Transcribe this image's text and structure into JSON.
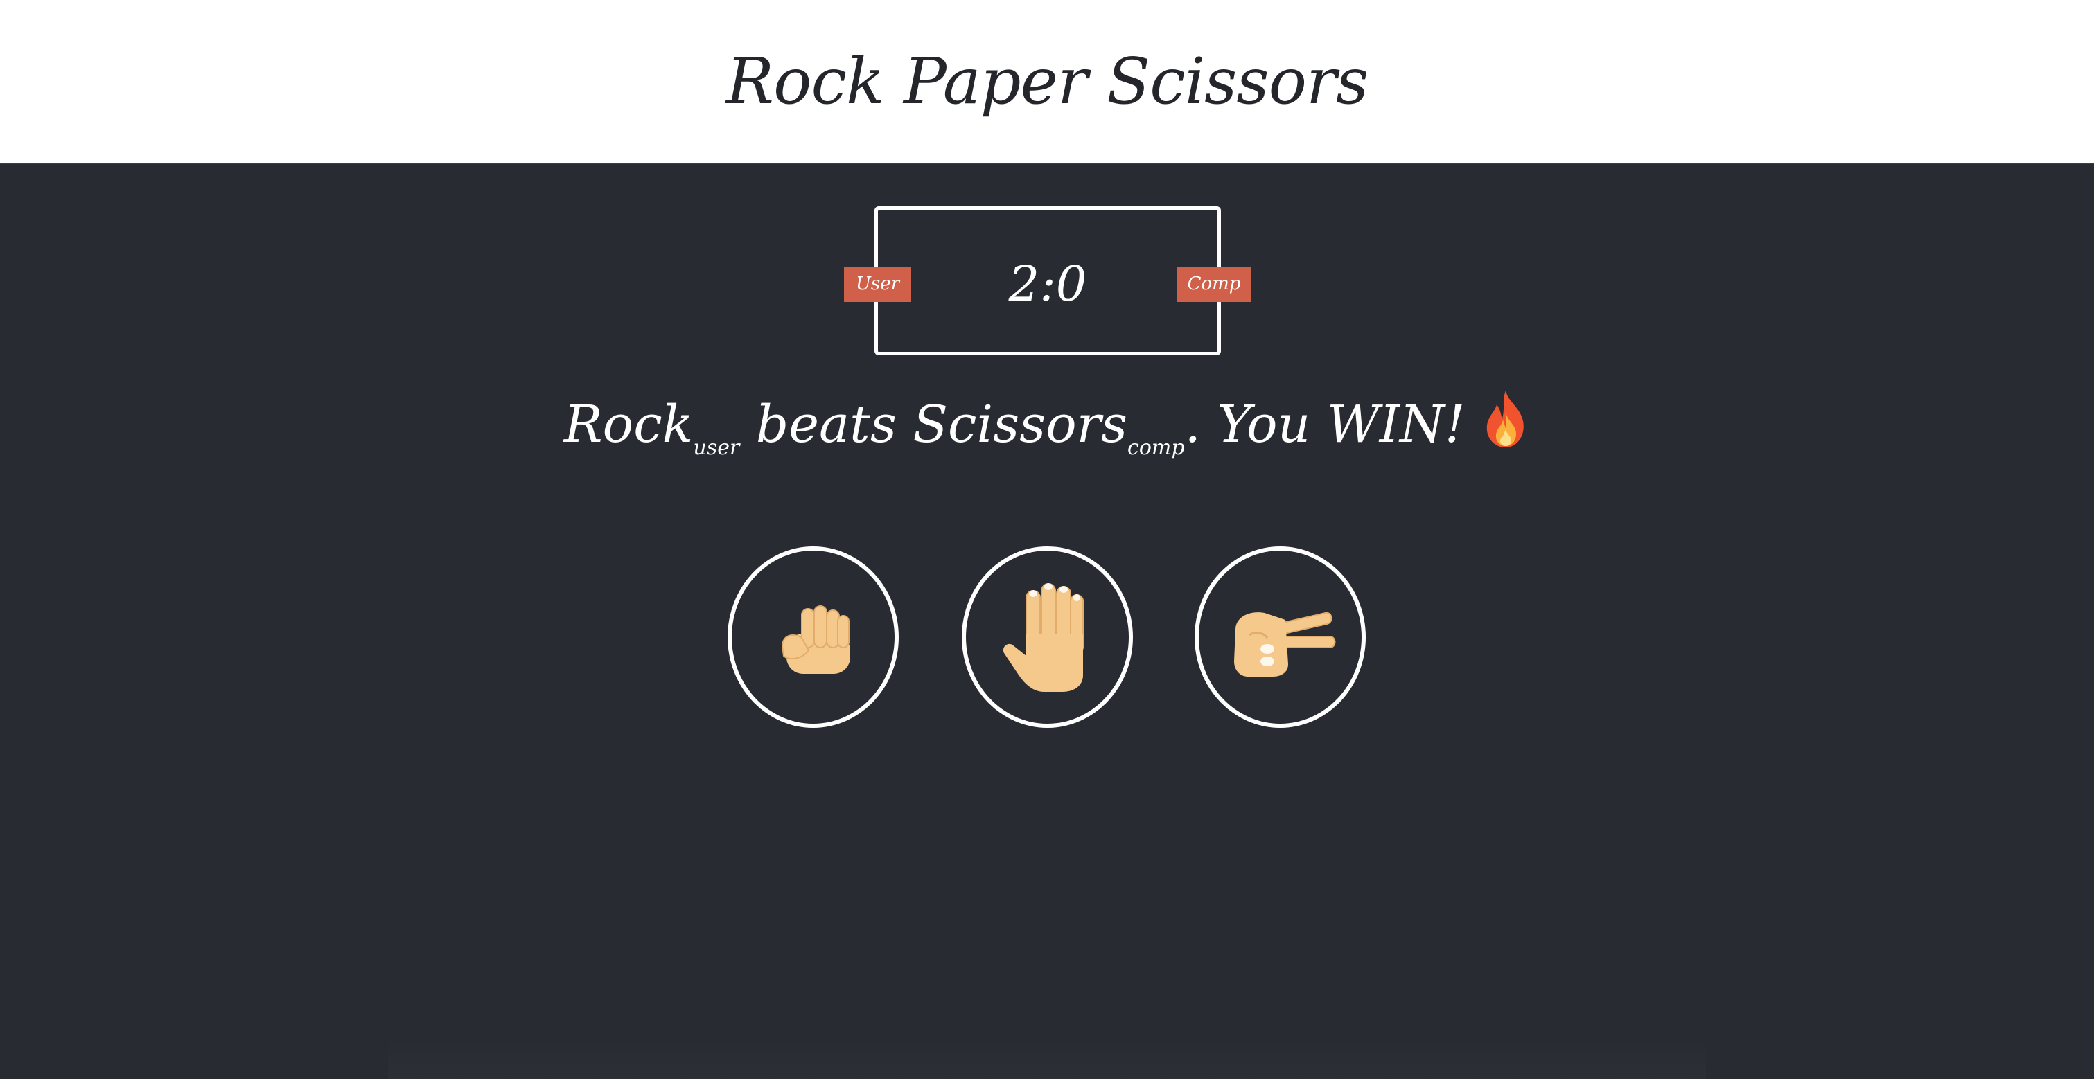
{
  "header": {
    "title": "Rock Paper Scissors"
  },
  "scoreboard": {
    "user_label": "User",
    "comp_label": "Comp",
    "score": "2:0"
  },
  "result": {
    "user_choice": "Rock",
    "user_tag": "user",
    "verb": "beats",
    "comp_choice": "Scissors",
    "comp_tag": "comp",
    "outcome": ". You WIN!",
    "emoji": "🔥"
  },
  "choices": [
    {
      "id": "rock",
      "icon": "raised-fist-icon"
    },
    {
      "id": "paper",
      "icon": "raised-hand-icon"
    },
    {
      "id": "scissors",
      "icon": "victory-hand-icon"
    }
  ],
  "colors": {
    "background": "#282b32",
    "header_bg": "#ffffff",
    "title_text": "#24262b",
    "badge": "#d0604a",
    "border": "#ffffff",
    "skin": "#f5c98c"
  }
}
